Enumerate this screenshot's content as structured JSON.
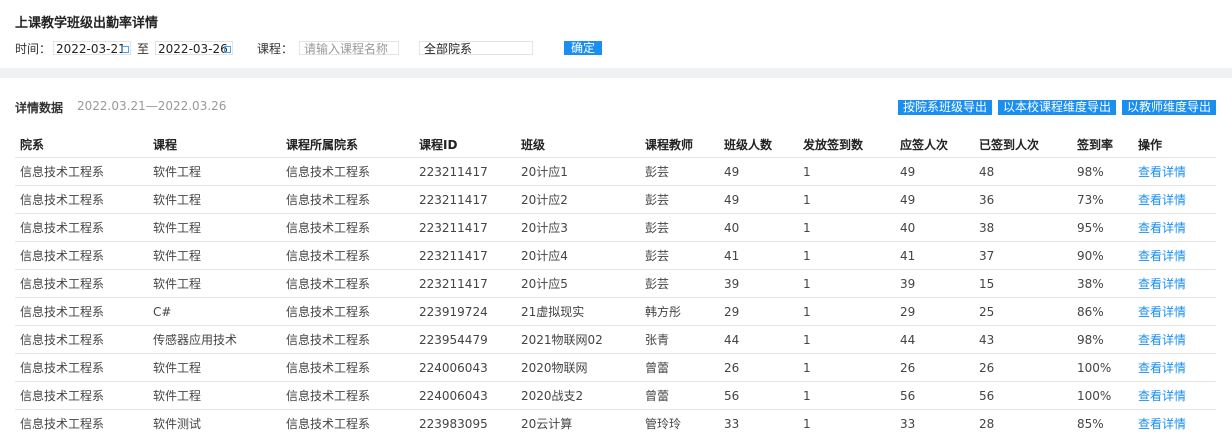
{
  "header": {
    "title": "上课教学班级出勤率详情"
  },
  "filters": {
    "time_label": "时间：",
    "start_date": "2022-03-21",
    "to_label": "至",
    "end_date": "2022-03-26",
    "course_label": "课程：",
    "course_placeholder": "请输入课程名称",
    "department_selected": "全部院系",
    "confirm_label": "确定"
  },
  "detail": {
    "title": "详情数据",
    "range": "2022.03.21—2022.03.26",
    "export_by_department": "按院系班级导出",
    "export_by_course": "以本校课程维度导出",
    "export_by_teacher": "以教师维度导出"
  },
  "table": {
    "columns": [
      "院系",
      "课程",
      "课程所属院系",
      "课程ID",
      "班级",
      "课程教师",
      "班级人数",
      "发放签到数",
      "应签人次",
      "已签到人次",
      "签到率",
      "操作"
    ],
    "rows": [
      [
        "信息技术工程系",
        "软件工程",
        "信息技术工程系",
        "223211417",
        "20计应1",
        "彭芸",
        "49",
        "1",
        "49",
        "48",
        "98%",
        "查看详情"
      ],
      [
        "信息技术工程系",
        "软件工程",
        "信息技术工程系",
        "223211417",
        "20计应2",
        "彭芸",
        "49",
        "1",
        "49",
        "36",
        "73%",
        "查看详情"
      ],
      [
        "信息技术工程系",
        "软件工程",
        "信息技术工程系",
        "223211417",
        "20计应3",
        "彭芸",
        "40",
        "1",
        "40",
        "38",
        "95%",
        "查看详情"
      ],
      [
        "信息技术工程系",
        "软件工程",
        "信息技术工程系",
        "223211417",
        "20计应4",
        "彭芸",
        "41",
        "1",
        "41",
        "37",
        "90%",
        "查看详情"
      ],
      [
        "信息技术工程系",
        "软件工程",
        "信息技术工程系",
        "223211417",
        "20计应5",
        "彭芸",
        "39",
        "1",
        "39",
        "15",
        "38%",
        "查看详情"
      ],
      [
        "信息技术工程系",
        "C#",
        "信息技术工程系",
        "223919724",
        "21虚拟现实",
        "韩方彤",
        "29",
        "1",
        "29",
        "25",
        "86%",
        "查看详情"
      ],
      [
        "信息技术工程系",
        "传感器应用技术",
        "信息技术工程系",
        "223954479",
        "2021物联网02",
        "张青",
        "44",
        "1",
        "44",
        "43",
        "98%",
        "查看详情"
      ],
      [
        "信息技术工程系",
        "软件工程",
        "信息技术工程系",
        "224006043",
        "2020物联网",
        "曾蕾",
        "26",
        "1",
        "26",
        "26",
        "100%",
        "查看详情"
      ],
      [
        "信息技术工程系",
        "软件工程",
        "信息技术工程系",
        "224006043",
        "2020战支2",
        "曾蕾",
        "56",
        "1",
        "56",
        "56",
        "100%",
        "查看详情"
      ],
      [
        "信息技术工程系",
        "软件测试",
        "信息技术工程系",
        "223983095",
        "20云计算",
        "管玲玲",
        "33",
        "1",
        "33",
        "28",
        "85%",
        "查看详情"
      ]
    ]
  },
  "colors": {
    "accent": "#1a8ff0",
    "band": "#f0f1f3"
  }
}
